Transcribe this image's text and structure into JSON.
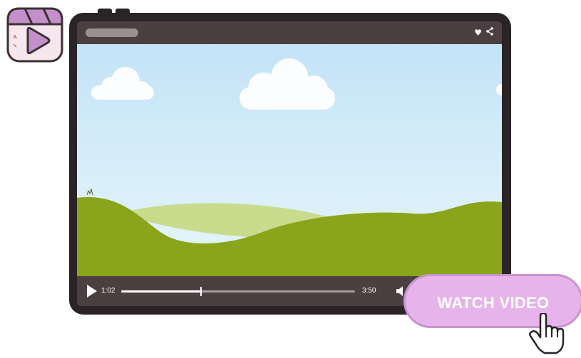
{
  "player": {
    "current_time": "1:02",
    "duration": "3:50",
    "progress": 0.34,
    "titlebar_icons": {
      "like": "heart-icon",
      "share": "share-icon"
    }
  },
  "cta": {
    "label": "WATCH VIDEO",
    "icon": "pointing-hand-icon"
  },
  "logo": {
    "icon": "play-icon"
  },
  "colors": {
    "frame": "#2a2426",
    "bar": "#4b3f41",
    "sky": "#c3e3f7",
    "grass_dark": "#8aa41c",
    "grass_light": "#c9dc8e",
    "button": "#e6b4ea",
    "logo": "#c48fcb"
  }
}
